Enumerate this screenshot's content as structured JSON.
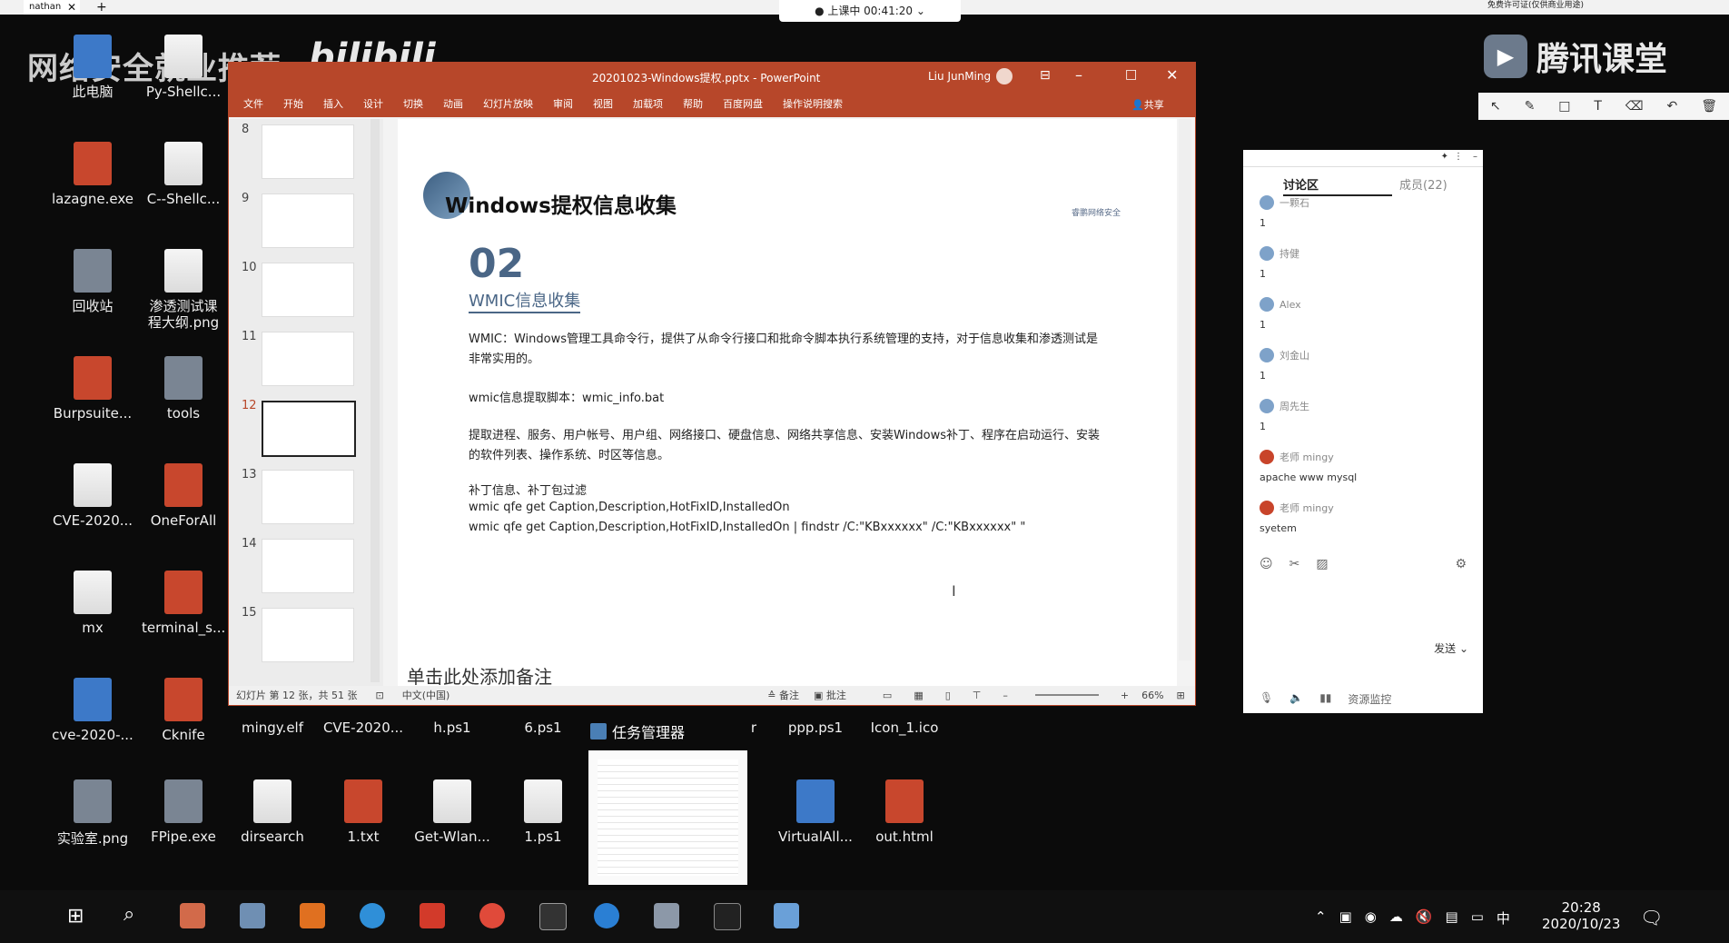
{
  "browser_tab": {
    "title": "nathan",
    "close": "✕",
    "new_tab": "+"
  },
  "class_timer": "● 上课中 00:41:20 ⌄",
  "top_right_text": "免费许可证(仅供商业用途)",
  "watermark_text": "网络安全就业推荐",
  "bilibili_text": "bilibili",
  "tencent": {
    "brand": "腾讯课堂"
  },
  "annotation_tools": [
    "select-icon",
    "pen-icon",
    "shape-icon",
    "text-icon",
    "eraser-icon",
    "undo-icon",
    "delete-icon"
  ],
  "desktop_icons_left": [
    {
      "label": "此电脑"
    },
    {
      "label": "Py-Shellc..."
    },
    {
      "label": "lazagne.exe"
    },
    {
      "label": "C--Shellc..."
    },
    {
      "label": "回收站"
    },
    {
      "label": "渗透测试课\n程大纲.png"
    },
    {
      "label": "Burpsuite..."
    },
    {
      "label": "tools"
    },
    {
      "label": "CVE-2020..."
    },
    {
      "label": "OneForAll"
    },
    {
      "label": "mx"
    },
    {
      "label": "terminal_s..."
    },
    {
      "label": "cve-2020-..."
    },
    {
      "label": "Cknife"
    }
  ],
  "desktop_icons_bottom_row1": [
    {
      "label": "mingy.elf"
    },
    {
      "label": "CVE-2020..."
    },
    {
      "label": "h.ps1"
    },
    {
      "label": "6.ps1"
    },
    {
      "label": "r"
    },
    {
      "label": "ppp.ps1"
    },
    {
      "label": "Icon_1.ico"
    }
  ],
  "desktop_icons_bottom_row2": [
    {
      "label": "实验室.png"
    },
    {
      "label": "FPipe.exe"
    },
    {
      "label": "dirsearch"
    },
    {
      "label": "1.txt"
    },
    {
      "label": "Get-Wlan..."
    },
    {
      "label": "1.ps1"
    },
    {
      "label": "VirtualAll..."
    },
    {
      "label": "out.html"
    }
  ],
  "ppt": {
    "title": "20201023-Windows提权.pptx  -  PowerPoint",
    "user": "Liu JunMing",
    "menu": [
      "文件",
      "开始",
      "插入",
      "设计",
      "切换",
      "动画",
      "幻灯片放映",
      "审阅",
      "视图",
      "加载项",
      "帮助",
      "百度网盘",
      "操作说明搜索"
    ],
    "share": "共享",
    "thumbnails": [
      "8",
      "9",
      "10",
      "11",
      "12",
      "13",
      "14",
      "15"
    ],
    "selected_thumbnail": "12",
    "slide": {
      "heading": "Windows提权信息收集",
      "number": "02",
      "subtitle": "WMIC信息收集",
      "logo_text": "睿鹏网络安全",
      "para1": "WMIC：Windows管理工具命令行，提供了从命令行接口和批命令脚本执行系统管理的支持，对于信息收集和渗透测试是非常实用的。",
      "para2": "wmic信息提取脚本：wmic_info.bat",
      "para3": "提取进程、服务、用户帐号、用户组、网络接口、硬盘信息、网络共享信息、安装Windows补丁、程序在启动运行、安装的软件列表、操作系统、时区等信息。",
      "para4": "补丁信息、补丁包过滤",
      "cmd1": "wmic qfe get Caption,Description,HotFixID,InstalledOn",
      "cmd2": "wmic qfe get Caption,Description,HotFixID,InstalledOn | findstr /C:\"KBxxxxxx\" /C:\"KBxxxxxx\"  \""
    },
    "notes_placeholder": "单击此处添加备注",
    "status": {
      "slide_info": "幻灯片 第 12 张，共 51 张",
      "language": "中文(中国)",
      "notes_btn": "备注",
      "comments_btn": "批注",
      "zoom": "66%"
    }
  },
  "chat": {
    "tab_discussion": "讨论区",
    "tab_members": "成员(22)",
    "messages": [
      {
        "name": "一颗石",
        "text": "1"
      },
      {
        "name": "持健",
        "text": "1"
      },
      {
        "name": "Alex",
        "text": "1"
      },
      {
        "name": "刘金山",
        "text": "1"
      },
      {
        "name": "周先生",
        "text": "1"
      },
      {
        "name": "老师 mingy",
        "text": "apache www mysql"
      },
      {
        "name": "老师 mingy",
        "text": "syetem"
      }
    ],
    "send": "发送",
    "resource": "资源监控"
  },
  "task_manager_label": "任务管理器",
  "taskbar": {
    "time": "20:28",
    "date": "2020/10/23",
    "ime": "中"
  }
}
